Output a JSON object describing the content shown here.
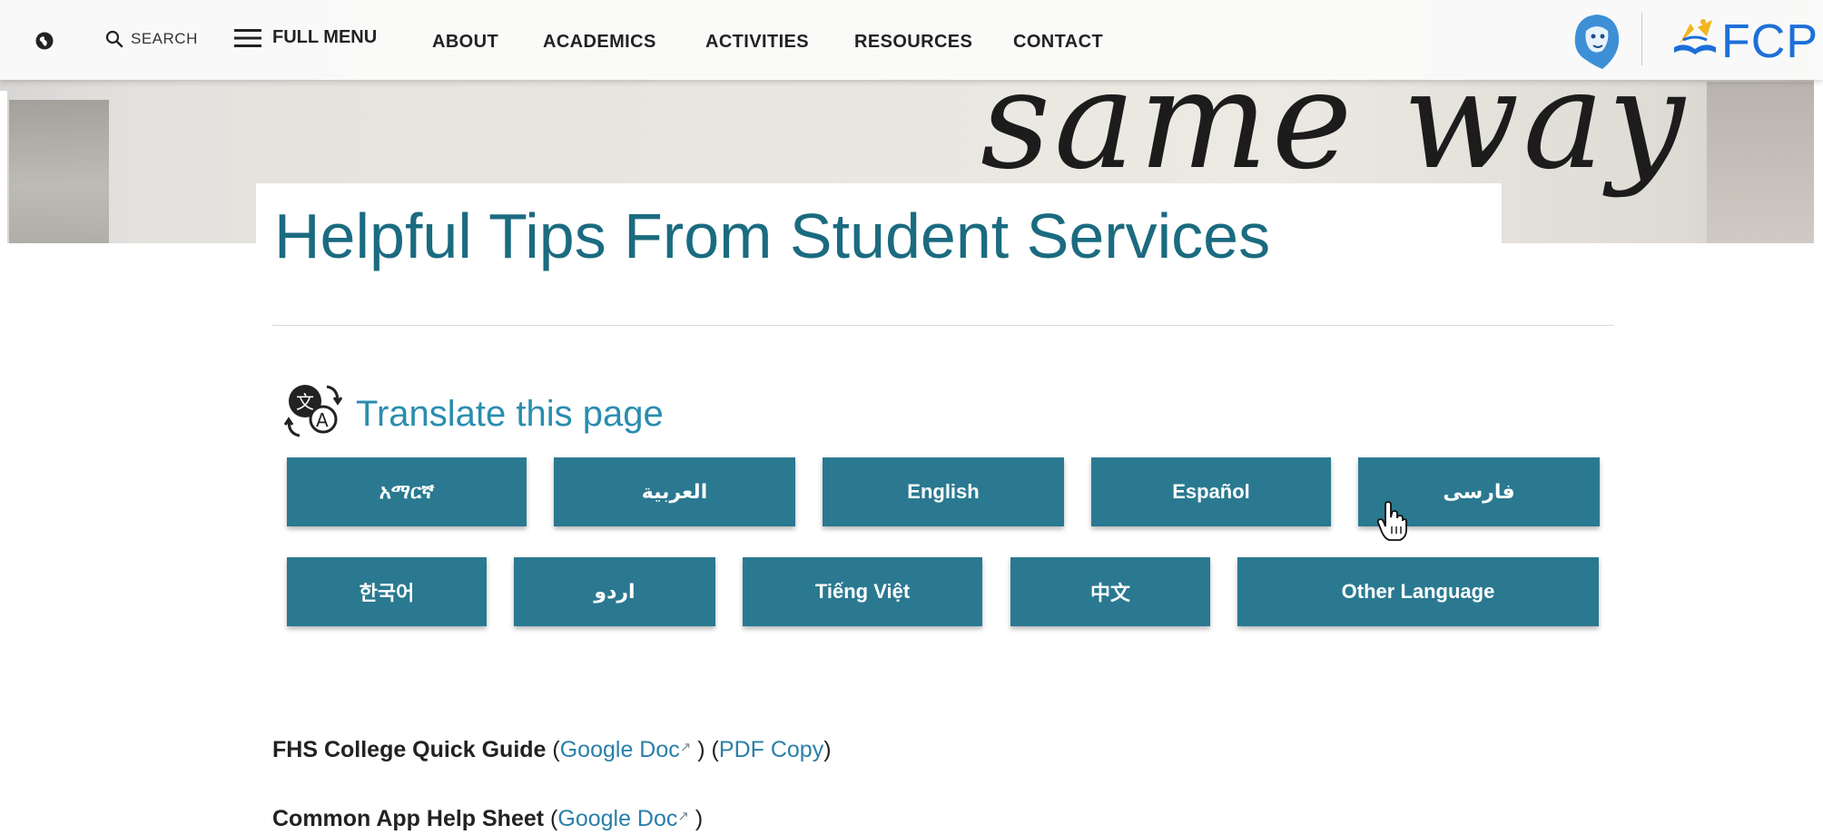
{
  "nav": {
    "search_label": "SEARCH",
    "full_menu_label": "FULL MENU",
    "links": [
      "ABOUT",
      "ACADEMICS",
      "ACTIVITIES",
      "RESOURCES",
      "CONTACT"
    ],
    "logo_text": "FCP"
  },
  "hero": {
    "art_text": "same way"
  },
  "page": {
    "title": "Helpful Tips From Student Services"
  },
  "translate": {
    "heading": "Translate this page",
    "row1": [
      "አማርኛ",
      "العربية",
      "English",
      "Español",
      "فارسی"
    ],
    "row2": [
      "한국어",
      "اردو",
      "Tiếng Việt",
      "中文",
      "Other Language"
    ]
  },
  "docs": [
    {
      "title": "FHS College Quick Guide",
      "open": "(",
      "link1": "Google Doc",
      "mid": " ) (",
      "link2": "PDF Copy",
      "close": ")"
    },
    {
      "title": "Common App Help Sheet",
      "open": "(",
      "link1": "Google Doc",
      "close": " )"
    }
  ],
  "colors": {
    "button": "#2a7990",
    "title": "#1b6b80",
    "link": "#2a7fa8",
    "logo": "#1d6fd8"
  }
}
